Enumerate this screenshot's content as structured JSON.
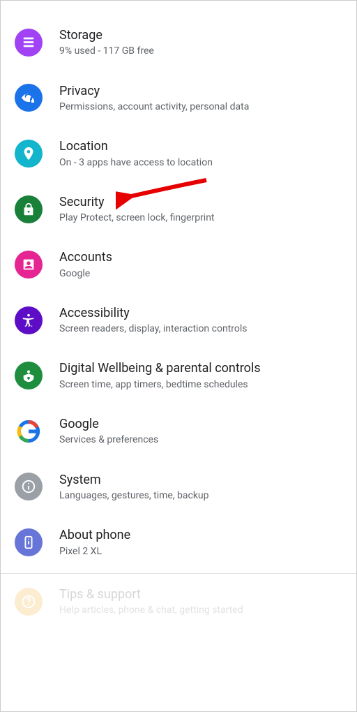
{
  "settings": [
    {
      "key": "storage",
      "title": "Storage",
      "subtitle": "9% used - 117 GB free",
      "icon": "storage-icon",
      "bg": "#a142f4"
    },
    {
      "key": "privacy",
      "title": "Privacy",
      "subtitle": "Permissions, account activity, personal data",
      "icon": "eye-lock-icon",
      "bg": "#1a73e8"
    },
    {
      "key": "location",
      "title": "Location",
      "subtitle": "On - 3 apps have access to location",
      "icon": "location-pin-icon",
      "bg": "#12b5cb"
    },
    {
      "key": "security",
      "title": "Security",
      "subtitle": "Play Protect, screen lock, fingerprint",
      "icon": "lock-icon",
      "bg": "#188038"
    },
    {
      "key": "accounts",
      "title": "Accounts",
      "subtitle": "Google",
      "icon": "account-box-icon",
      "bg": "#e52592"
    },
    {
      "key": "accessibility",
      "title": "Accessibility",
      "subtitle": "Screen readers, display, interaction controls",
      "icon": "accessibility-icon",
      "bg": "#5e0dc6"
    },
    {
      "key": "wellbeing",
      "title": "Digital Wellbeing & parental controls",
      "subtitle": "Screen time, app timers, bedtime schedules",
      "icon": "heart-badge-icon",
      "bg": "#1e8e3e"
    },
    {
      "key": "google",
      "title": "Google",
      "subtitle": "Services & preferences",
      "icon": "google-g-icon",
      "bg": "#ffffff"
    },
    {
      "key": "system",
      "title": "System",
      "subtitle": "Languages, gestures, time, backup",
      "icon": "info-icon",
      "bg": "#9aa0a6"
    },
    {
      "key": "about",
      "title": "About phone",
      "subtitle": "Pixel 2 XL",
      "icon": "phone-info-icon",
      "bg": "#6775d8"
    },
    {
      "key": "tips",
      "title": "Tips & support",
      "subtitle": "Help articles, phone & chat, getting started",
      "icon": "help-icon",
      "bg": "#f29900",
      "faded": true
    }
  ],
  "annotation": {
    "target": "security",
    "arrow_color": "#e60000"
  }
}
